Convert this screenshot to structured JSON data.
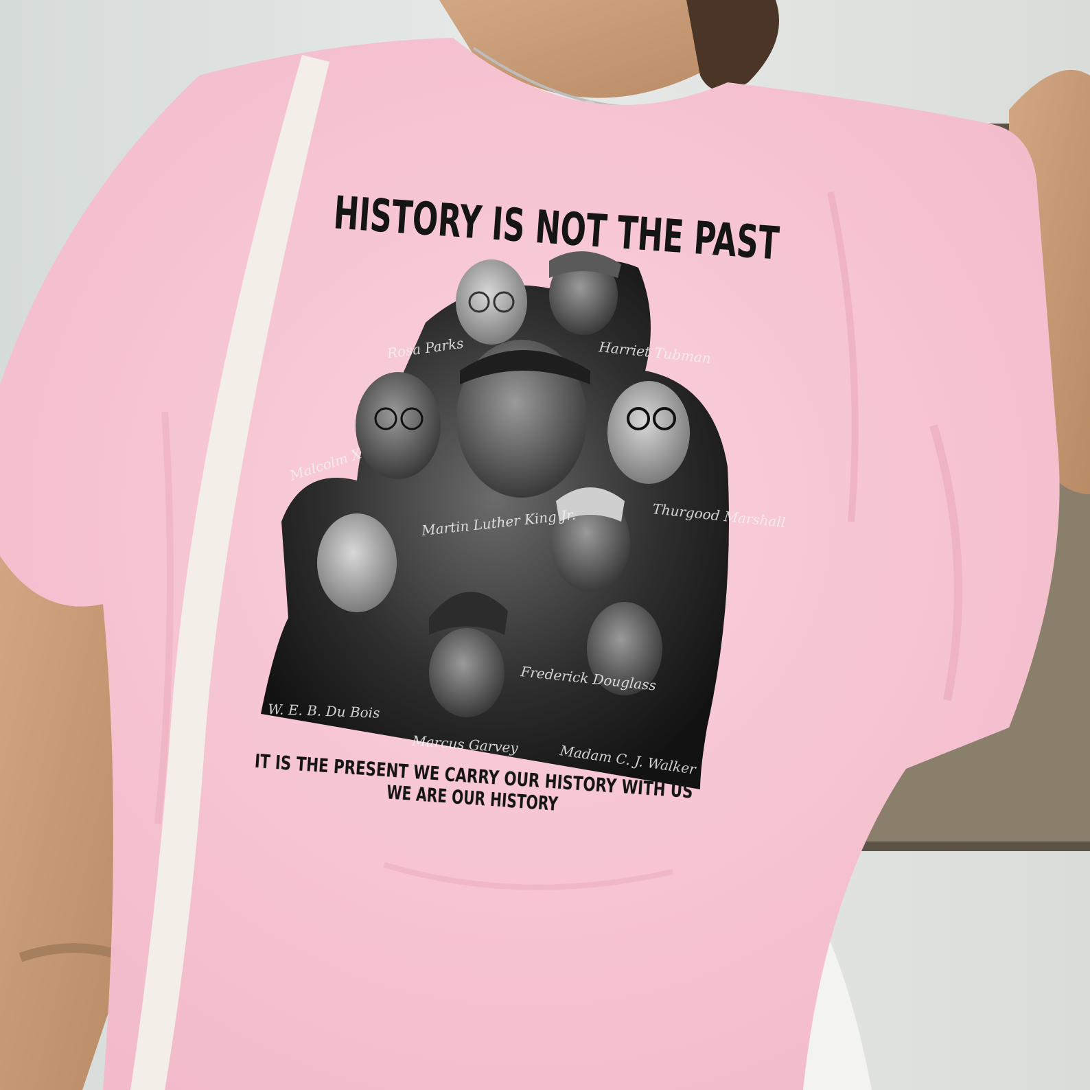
{
  "shirt": {
    "headline": "HISTORY IS NOT THE PAST",
    "line_1": "IT IS THE PRESENT WE CARRY OUR HISTORY WITH US",
    "line_2": "WE ARE OUR HISTORY"
  },
  "signatures": [
    "Rosa Parks",
    "Harriet Tubman",
    "Malcolm X",
    "Martin Luther King Jr.",
    "Thurgood Marshall",
    "Frederick Douglass",
    "W. E. B. Du Bois",
    "Marcus Garvey",
    "Madam C. J. Walker"
  ],
  "colors": {
    "shirt_pink": "#f7c6d3",
    "shirt_shadow": "#eaa9bb",
    "skin": "#c69b77",
    "wall": "#dfe3e1",
    "print_black": "#151515"
  }
}
